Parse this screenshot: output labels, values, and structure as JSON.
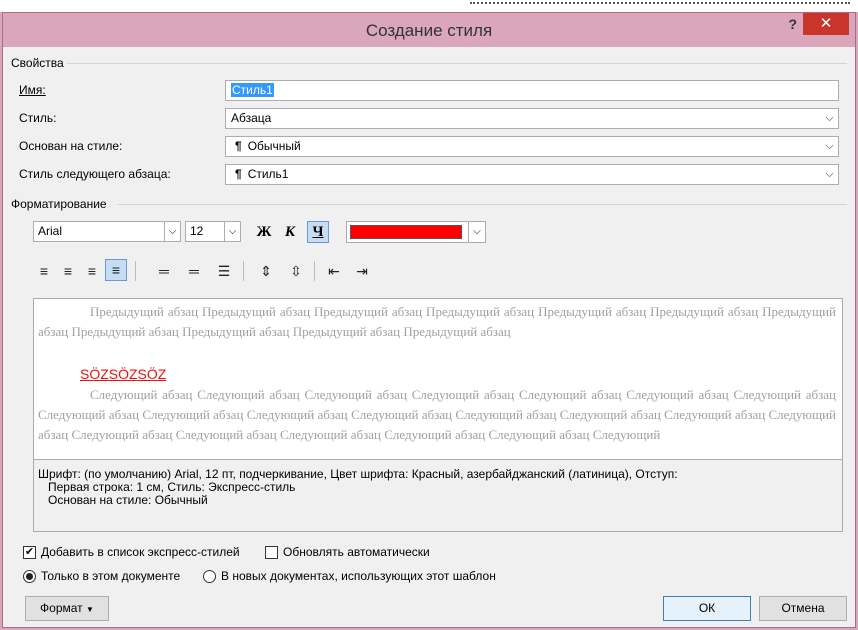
{
  "window": {
    "title": "Создание стиля",
    "help": "?",
    "close": "✕"
  },
  "properties": {
    "section": "Свойства",
    "name_label": "Имя:",
    "name_value": "Стиль1",
    "type_label": "Стиль:",
    "type_value": "Абзаца",
    "based_label": "Основан на стиле:",
    "based_value": "Обычный",
    "next_label": "Стиль следующего абзаца:",
    "next_value": "Стиль1"
  },
  "formatting": {
    "section": "Форматирование",
    "font": "Arial",
    "size": "12",
    "bold": "Ж",
    "italic": "К",
    "underline": "Ч",
    "font_color": "#ff0000",
    "underline_active": true
  },
  "preview": {
    "previous_text": "Предыдущий абзац Предыдущий абзац Предыдущий абзац Предыдущий абзац Предыдущий абзац Предыдущий абзац Предыдущий абзац Предыдущий абзац Предыдущий абзац Предыдущий абзац Предыдущий абзац",
    "sample_text": "SÖZSÖZSÖZ",
    "next_text": "Следующий абзац Следующий абзац Следующий абзац Следующий абзац Следующий абзац Следующий абзац Следующий абзац Следующий абзац Следующий абзац Следующий абзац Следующий абзац Следующий абзац Следующий абзац Следующий абзац Следующий абзац Следующий абзац Следующий абзац Следующий абзац Следующий абзац Следующий абзац Следующий"
  },
  "description": {
    "line1": "Шрифт: (по умолчанию) Arial, 12 пт, подчеркивание, Цвет шрифта: Красный, азербайджанский (латиница), Отступ:",
    "line2": "Первая строка:  1 см, Стиль: Экспресс-стиль",
    "line3": "Основан на стиле: Обычный"
  },
  "options": {
    "add_quick": "Добавить в список экспресс-стилей",
    "add_quick_checked": true,
    "auto_update": "Обновлять автоматически",
    "auto_update_checked": false,
    "only_doc": "Только в этом документе",
    "new_docs": "В новых документах, использующих этот шаблон"
  },
  "buttons": {
    "format": "Формат",
    "ok": "ОК",
    "cancel": "Отмена"
  }
}
